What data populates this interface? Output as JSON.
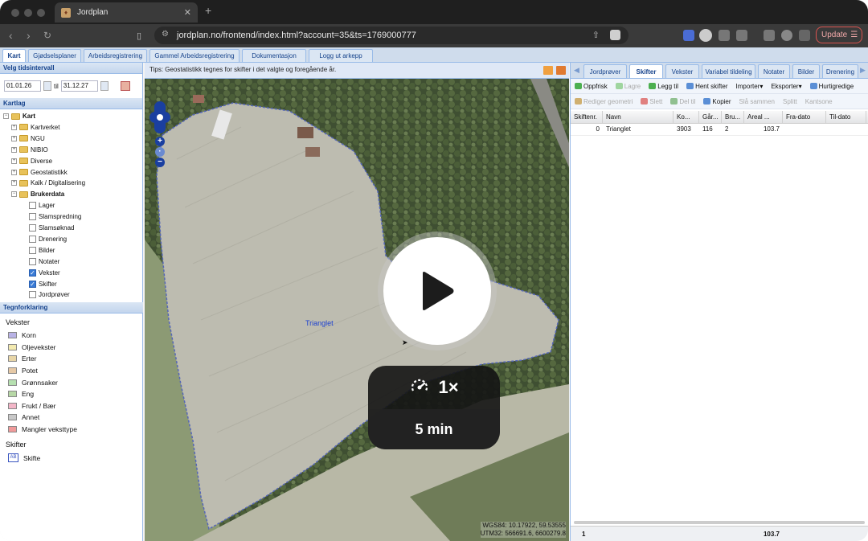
{
  "browser": {
    "tab_title": "Jordplan",
    "url": "jordplan.no/frontend/index.html?account=35&ts=1769000777",
    "update_label": "Update"
  },
  "app_tabs": [
    "Kart",
    "Gjødselsplaner",
    "Arbeidsregistrering",
    "Gammel Arbeidsregistrering",
    "Dokumentasjon",
    "Logg ut arkepp"
  ],
  "left": {
    "time_title": "Velg tidsintervall",
    "date_from": "01.01.26",
    "til_label": "til",
    "date_to": "31.12.27",
    "layers_title": "Kartlag",
    "tree": [
      {
        "label": "Kart",
        "kind": "root"
      },
      {
        "label": "Kartverket",
        "kind": "folder"
      },
      {
        "label": "NGU",
        "kind": "folder"
      },
      {
        "label": "NIBIO",
        "kind": "folder"
      },
      {
        "label": "Diverse",
        "kind": "folder"
      },
      {
        "label": "Geostatistikk",
        "kind": "folder"
      },
      {
        "label": "Kalk / Digitalisering",
        "kind": "folder"
      },
      {
        "label": "Brukerdata",
        "kind": "folder-open"
      },
      {
        "label": "Lager",
        "kind": "check",
        "checked": false
      },
      {
        "label": "Slamspredning",
        "kind": "check",
        "checked": false
      },
      {
        "label": "Slamsøknad",
        "kind": "check",
        "checked": false
      },
      {
        "label": "Drenering",
        "kind": "check",
        "checked": false
      },
      {
        "label": "Bilder",
        "kind": "check",
        "checked": false
      },
      {
        "label": "Notater",
        "kind": "check",
        "checked": false
      },
      {
        "label": "Vekster",
        "kind": "check",
        "checked": true
      },
      {
        "label": "Skifter",
        "kind": "check",
        "checked": true
      },
      {
        "label": "Jordprøver",
        "kind": "check",
        "checked": false
      }
    ],
    "legend_title": "Tegnforklaring",
    "legend_group1": "Vekster",
    "legend_items": [
      {
        "label": "Korn",
        "color": "#b9b3e6"
      },
      {
        "label": "Oljevekster",
        "color": "#f3eab0"
      },
      {
        "label": "Erter",
        "color": "#e8d6a8"
      },
      {
        "label": "Potet",
        "color": "#e6c9a6"
      },
      {
        "label": "Grønnsaker",
        "color": "#b6e0b0"
      },
      {
        "label": "Eng",
        "color": "#b7d8a6"
      },
      {
        "label": "Frukt / Bær",
        "color": "#f3b6c8"
      },
      {
        "label": "Annet",
        "color": "#c8c8c8"
      },
      {
        "label": "Mangler veksttype",
        "color": "#f09a9a"
      }
    ],
    "legend_group2": "Skifter",
    "legend_skifte": "Skifte"
  },
  "map": {
    "tips": "Tips: Geostatistikk tegnes for skifter i det valgte og foregående år.",
    "field_label": "Trianglet",
    "coords_wgs": "WGS84: 10.17922, 59.53555",
    "coords_utm": "UTM32: 566691.6, 6600279.8",
    "speed_label": "1×",
    "duration_label": "5 min"
  },
  "right": {
    "tabs": [
      "Jordprøver",
      "Skifter",
      "Vekster",
      "Variabel tildeling",
      "Notater",
      "Bilder",
      "Drenering"
    ],
    "toolbar1": [
      {
        "label": "Oppfrisk",
        "enabled": true,
        "color": "#4caf50"
      },
      {
        "label": "Lagre",
        "enabled": false,
        "color": "#9fd59f"
      },
      {
        "label": "Legg til",
        "enabled": true,
        "color": "#4caf50"
      },
      {
        "label": "Hent skifter",
        "enabled": true,
        "color": "#5b8fd6"
      },
      {
        "label": "Importer▾",
        "enabled": true,
        "color": ""
      },
      {
        "label": "Eksporter▾",
        "enabled": true,
        "color": ""
      },
      {
        "label": "Hurtigredige",
        "enabled": true,
        "color": "#5b8fd6"
      }
    ],
    "toolbar2": [
      {
        "label": "Rediger geometri",
        "enabled": false,
        "color": "#d0b070"
      },
      {
        "label": "Slett",
        "enabled": false,
        "color": "#e08080"
      },
      {
        "label": "Del til",
        "enabled": false,
        "color": "#90c090"
      },
      {
        "label": "Kopier",
        "enabled": true,
        "color": "#5b8fd6"
      },
      {
        "label": "Slå sammen",
        "enabled": false,
        "color": ""
      },
      {
        "label": "Splitt",
        "enabled": false,
        "color": ""
      },
      {
        "label": "Kantsone",
        "enabled": false,
        "color": ""
      }
    ],
    "columns": [
      "Skiftenr.",
      "Navn",
      "Ko...",
      "Går...",
      "Bru...",
      "Areal ...",
      "Fra-dato",
      "Til-dato"
    ],
    "rows": [
      [
        "0",
        "Trianglet",
        "3903",
        "116",
        "2",
        "103.7",
        "",
        ""
      ]
    ],
    "footer": [
      "1",
      "",
      "",
      "",
      "",
      "103.7",
      "",
      ""
    ]
  }
}
